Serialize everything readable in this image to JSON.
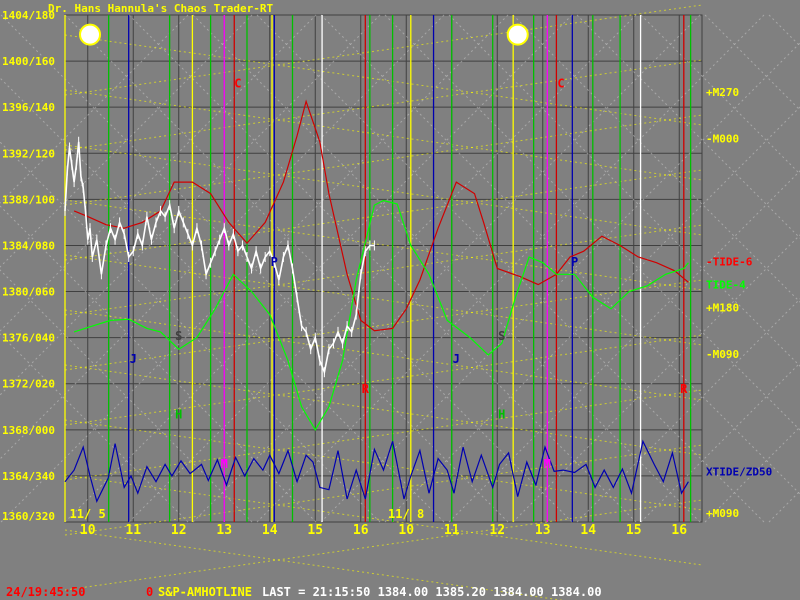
{
  "header": {
    "title": "Dr. Hans Hannula's Chaos Trader-RT"
  },
  "status_bar": {
    "time": "24/19:45:50",
    "index": "0",
    "symbol": "S&P-AMHOTLINE",
    "quote": "LAST = 21:15:50 1384.00 1385.20 1384.00 1384.00"
  },
  "colors": {
    "background": "#808080",
    "grid": "#404040",
    "yellow": "#ffff00",
    "green": "#00c000",
    "bright_green": "#00ff00",
    "red": "#d00000",
    "blue": "#0000b0",
    "magenta": "#ff00ff",
    "white": "#ffffff"
  },
  "chart_data": {
    "type": "line",
    "title": "Dr. Hans Hannula's Chaos Trader-RT",
    "y_tick_labels": [
      "1404/180",
      "1400/160",
      "1396/140",
      "1392/120",
      "1388/100",
      "1384/080",
      "1380/060",
      "1376/040",
      "1372/020",
      "1368/000",
      "1364/340",
      "1360/320"
    ],
    "y_tick_values": [
      1404,
      1400,
      1396,
      1392,
      1388,
      1384,
      1380,
      1376,
      1372,
      1368,
      1364,
      1360
    ],
    "ylim": [
      1360,
      1404
    ],
    "xlim": [
      0,
      14
    ],
    "x_ticks": [
      {
        "x": 0.5,
        "label": "10"
      },
      {
        "x": 1.5,
        "label": "11"
      },
      {
        "x": 2.5,
        "label": "12"
      },
      {
        "x": 3.5,
        "label": "13"
      },
      {
        "x": 4.5,
        "label": "14"
      },
      {
        "x": 5.5,
        "label": "15"
      },
      {
        "x": 6.5,
        "label": "16"
      },
      {
        "x": 7.5,
        "label": "10"
      },
      {
        "x": 8.5,
        "label": "11"
      },
      {
        "x": 9.5,
        "label": "12"
      },
      {
        "x": 10.5,
        "label": "13"
      },
      {
        "x": 11.5,
        "label": "14"
      },
      {
        "x": 12.5,
        "label": "15"
      },
      {
        "x": 13.5,
        "label": "16"
      }
    ],
    "date_labels": [
      {
        "x": 0.1,
        "label": "11/ 5"
      },
      {
        "x": 7.1,
        "label": "11/ 8"
      }
    ],
    "right_labels": [
      {
        "y": 1397.3,
        "label": "+M270",
        "color": "#ffff00"
      },
      {
        "y": 1393.3,
        "label": "-M000",
        "color": "#ffff00"
      },
      {
        "y": 1382.6,
        "label": "-TIDE-6",
        "color": "#ff0000"
      },
      {
        "y": 1380.6,
        "label": "TIDE-4",
        "color": "#00ff00"
      },
      {
        "y": 1378.6,
        "label": "+M180",
        "color": "#ffff00"
      },
      {
        "y": 1374.6,
        "label": "-M090",
        "color": "#ffff00"
      },
      {
        "y": 1364.4,
        "label": "XTIDE/ZD50",
        "color": "#0000b0"
      },
      {
        "y": 1360.8,
        "label": "+M090",
        "color": "#ffff00"
      }
    ],
    "vertical_lines": [
      {
        "x": 0.0,
        "color": "yellow"
      },
      {
        "x": 0.96,
        "color": "green"
      },
      {
        "x": 1.4,
        "color": "blue"
      },
      {
        "x": 2.3,
        "color": "green"
      },
      {
        "x": 2.8,
        "color": "yellow"
      },
      {
        "x": 3.2,
        "color": "green"
      },
      {
        "x": 3.5,
        "color": "magenta"
      },
      {
        "x": 3.72,
        "color": "red"
      },
      {
        "x": 4.0,
        "color": "green"
      },
      {
        "x": 4.55,
        "color": "yellow"
      },
      {
        "x": 4.6,
        "color": "blue"
      },
      {
        "x": 5.0,
        "color": "green"
      },
      {
        "x": 5.65,
        "color": "white"
      },
      {
        "x": 6.6,
        "color": "red"
      },
      {
        "x": 6.7,
        "color": "green"
      },
      {
        "x": 7.2,
        "color": "green"
      },
      {
        "x": 7.6,
        "color": "yellow"
      },
      {
        "x": 8.1,
        "color": "blue"
      },
      {
        "x": 8.5,
        "color": "green"
      },
      {
        "x": 9.4,
        "color": "green"
      },
      {
        "x": 9.85,
        "color": "yellow"
      },
      {
        "x": 10.3,
        "color": "green"
      },
      {
        "x": 10.6,
        "color": "magenta"
      },
      {
        "x": 10.8,
        "color": "red"
      },
      {
        "x": 11.15,
        "color": "blue"
      },
      {
        "x": 11.6,
        "color": "green"
      },
      {
        "x": 12.2,
        "color": "green"
      },
      {
        "x": 12.65,
        "color": "white"
      },
      {
        "x": 13.6,
        "color": "red"
      },
      {
        "x": 13.75,
        "color": "green"
      }
    ],
    "event_markers": [
      {
        "x": 3.8,
        "y": 1397.7,
        "label": "C",
        "color": "#ff0000"
      },
      {
        "x": 10.9,
        "y": 1397.7,
        "label": "C",
        "color": "#ff0000"
      },
      {
        "x": 4.6,
        "y": 1382.2,
        "label": "P",
        "color": "#0000b0"
      },
      {
        "x": 11.2,
        "y": 1382.2,
        "label": "P",
        "color": "#0000b0"
      },
      {
        "x": 2.5,
        "y": 1375.8,
        "label": "S",
        "color": "#404040"
      },
      {
        "x": 9.6,
        "y": 1375.8,
        "label": "S",
        "color": "#404040"
      },
      {
        "x": 1.5,
        "y": 1373.8,
        "label": "J",
        "color": "#0000b0"
      },
      {
        "x": 8.6,
        "y": 1373.8,
        "label": "J",
        "color": "#0000b0"
      },
      {
        "x": 6.6,
        "y": 1371.2,
        "label": "R",
        "color": "#ff0000"
      },
      {
        "x": 13.6,
        "y": 1371.2,
        "label": "R",
        "color": "#ff0000"
      },
      {
        "x": 2.5,
        "y": 1369.0,
        "label": "H",
        "color": "#00c000"
      },
      {
        "x": 9.6,
        "y": 1369.0,
        "label": "H",
        "color": "#00c000"
      },
      {
        "x": 3.5,
        "y": 1364.7,
        "label": "M",
        "color": "#ff00ff"
      },
      {
        "x": 10.6,
        "y": 1364.7,
        "label": "M",
        "color": "#ff00ff"
      }
    ],
    "sun_symbols": [
      {
        "x": 0.55,
        "y": 1402.3
      },
      {
        "x": 9.95,
        "y": 1402.3
      }
    ],
    "series": [
      {
        "name": "TIDE-6",
        "color": "#d00000",
        "x": [
          0.2,
          0.5,
          0.9,
          1.3,
          1.7,
          2.1,
          2.4,
          2.8,
          3.2,
          3.6,
          4.0,
          4.4,
          4.8,
          5.1,
          5.3,
          5.6,
          5.8,
          6.2,
          6.5,
          6.8,
          7.2,
          7.5,
          7.8,
          8.2,
          8.6,
          9.0,
          9.2,
          9.5,
          10.0,
          10.4,
          10.8,
          11.1,
          11.4,
          11.8,
          12.2,
          12.6,
          13.0,
          13.4,
          13.7
        ],
        "y": [
          1387.0,
          1386.5,
          1385.8,
          1385.5,
          1386.0,
          1387.0,
          1389.5,
          1389.5,
          1388.5,
          1386.0,
          1384.2,
          1386.0,
          1389.5,
          1393.5,
          1396.5,
          1393.0,
          1388.5,
          1381.5,
          1377.5,
          1376.6,
          1376.8,
          1378.5,
          1381.0,
          1385.5,
          1389.5,
          1388.5,
          1386.0,
          1382.0,
          1381.3,
          1380.6,
          1381.5,
          1383.0,
          1383.5,
          1384.8,
          1384.0,
          1383.0,
          1382.5,
          1381.8,
          1380.8
        ]
      },
      {
        "name": "TIDE-4",
        "color": "#00ff00",
        "x": [
          0.2,
          0.6,
          1.0,
          1.4,
          1.8,
          2.1,
          2.5,
          2.9,
          3.3,
          3.7,
          4.1,
          4.5,
          4.9,
          5.2,
          5.5,
          5.8,
          6.1,
          6.4,
          6.8,
          7.0,
          7.3,
          7.6,
          8.0,
          8.4,
          8.9,
          9.3,
          9.6,
          9.9,
          10.2,
          10.5,
          10.8,
          11.2,
          11.6,
          12.0,
          12.4,
          12.8,
          13.2,
          13.6,
          13.7
        ],
        "y": [
          1376.5,
          1377.0,
          1377.5,
          1377.6,
          1376.8,
          1376.5,
          1375.0,
          1376.0,
          1378.5,
          1381.5,
          1380.0,
          1378.0,
          1374.0,
          1370.0,
          1368.0,
          1370.0,
          1374.0,
          1381.0,
          1387.5,
          1387.9,
          1387.6,
          1384.0,
          1381.5,
          1377.5,
          1376.0,
          1374.5,
          1375.5,
          1379.5,
          1383.0,
          1382.5,
          1381.5,
          1381.5,
          1379.5,
          1378.5,
          1380.0,
          1380.5,
          1381.5,
          1382.0,
          1382.5
        ]
      },
      {
        "name": "XTIDE/ZD50",
        "color": "#0000b0",
        "x": [
          0.0,
          0.2,
          0.4,
          0.55,
          0.7,
          0.95,
          1.1,
          1.3,
          1.45,
          1.6,
          1.8,
          2.0,
          2.2,
          2.35,
          2.55,
          2.75,
          3.0,
          3.15,
          3.35,
          3.55,
          3.75,
          3.95,
          4.15,
          4.35,
          4.5,
          4.7,
          4.9,
          5.1,
          5.3,
          5.45,
          5.6,
          5.8,
          6.0,
          6.2,
          6.4,
          6.6,
          6.8,
          7.0,
          7.2,
          7.45,
          7.6,
          7.8,
          8.0,
          8.2,
          8.4,
          8.55,
          8.75,
          8.95,
          9.15,
          9.4,
          9.55,
          9.75,
          9.95,
          10.15,
          10.35,
          10.55,
          10.75,
          10.95,
          11.2,
          11.45,
          11.65,
          11.85,
          12.05,
          12.25,
          12.45,
          12.7,
          12.95,
          13.15,
          13.35,
          13.55,
          13.7
        ],
        "y": [
          1363.5,
          1364.5,
          1366.5,
          1364.0,
          1361.8,
          1363.8,
          1366.8,
          1363.0,
          1364.0,
          1362.5,
          1364.8,
          1363.5,
          1365.0,
          1364.0,
          1365.3,
          1364.2,
          1365.0,
          1363.6,
          1365.4,
          1363.2,
          1365.6,
          1364.0,
          1365.5,
          1364.5,
          1365.8,
          1364.2,
          1366.2,
          1363.5,
          1365.8,
          1365.2,
          1363.0,
          1362.8,
          1366.2,
          1362.0,
          1364.5,
          1362.0,
          1366.3,
          1364.5,
          1367.0,
          1362.0,
          1364.0,
          1366.2,
          1362.5,
          1365.5,
          1364.5,
          1362.5,
          1366.5,
          1363.5,
          1365.8,
          1363.0,
          1365.0,
          1366.0,
          1362.2,
          1365.2,
          1363.2,
          1366.5,
          1364.4,
          1364.5,
          1364.3,
          1365.0,
          1363.0,
          1364.5,
          1363.0,
          1364.6,
          1362.5,
          1367.0,
          1365.0,
          1363.5,
          1366.0,
          1362.5,
          1363.5
        ]
      },
      {
        "name": "S&P",
        "color": "#ffffff",
        "x": [
          0.0,
          0.05,
          0.1,
          0.15,
          0.2,
          0.25,
          0.3,
          0.35,
          0.4,
          0.45,
          0.5,
          0.55,
          0.6,
          0.7,
          0.8,
          0.9,
          1.0,
          1.1,
          1.2,
          1.3,
          1.4,
          1.5,
          1.6,
          1.7,
          1.8,
          1.9,
          2.0,
          2.1,
          2.2,
          2.3,
          2.4,
          2.5,
          2.6,
          2.7,
          2.8,
          2.9,
          3.0,
          3.1,
          3.2,
          3.3,
          3.4,
          3.5,
          3.6,
          3.7,
          3.8,
          3.9,
          4.0,
          4.1,
          4.2,
          4.3,
          4.4,
          4.5,
          4.6,
          4.7,
          4.8,
          4.9,
          5.0,
          5.1,
          5.2,
          5.3,
          5.4,
          5.5,
          5.6,
          5.7,
          5.8,
          5.9,
          6.0,
          6.1,
          6.2,
          6.3,
          6.4,
          6.5,
          6.6,
          6.7,
          6.8
        ],
        "y": [
          1387.0,
          1390.5,
          1392.5,
          1391.0,
          1389.5,
          1391.0,
          1393.0,
          1390.0,
          1389.0,
          1387.0,
          1384.5,
          1385.5,
          1383.0,
          1384.5,
          1381.5,
          1384.0,
          1385.5,
          1384.5,
          1386.0,
          1385.0,
          1383.0,
          1383.5,
          1385.0,
          1384.0,
          1386.5,
          1384.5,
          1386.0,
          1387.0,
          1386.5,
          1387.5,
          1385.5,
          1387.0,
          1386.0,
          1385.0,
          1384.0,
          1385.5,
          1384.0,
          1381.5,
          1382.5,
          1383.5,
          1384.5,
          1385.5,
          1384.0,
          1385.0,
          1383.5,
          1384.0,
          1383.0,
          1382.0,
          1383.5,
          1382.0,
          1383.0,
          1383.5,
          1382.5,
          1381.0,
          1383.0,
          1384.0,
          1382.0,
          1379.5,
          1377.0,
          1376.5,
          1375.0,
          1376.0,
          1374.0,
          1373.0,
          1375.0,
          1375.5,
          1376.5,
          1375.5,
          1377.0,
          1376.5,
          1378.0,
          1381.5,
          1383.5,
          1384.0,
          1384.0
        ]
      }
    ]
  }
}
